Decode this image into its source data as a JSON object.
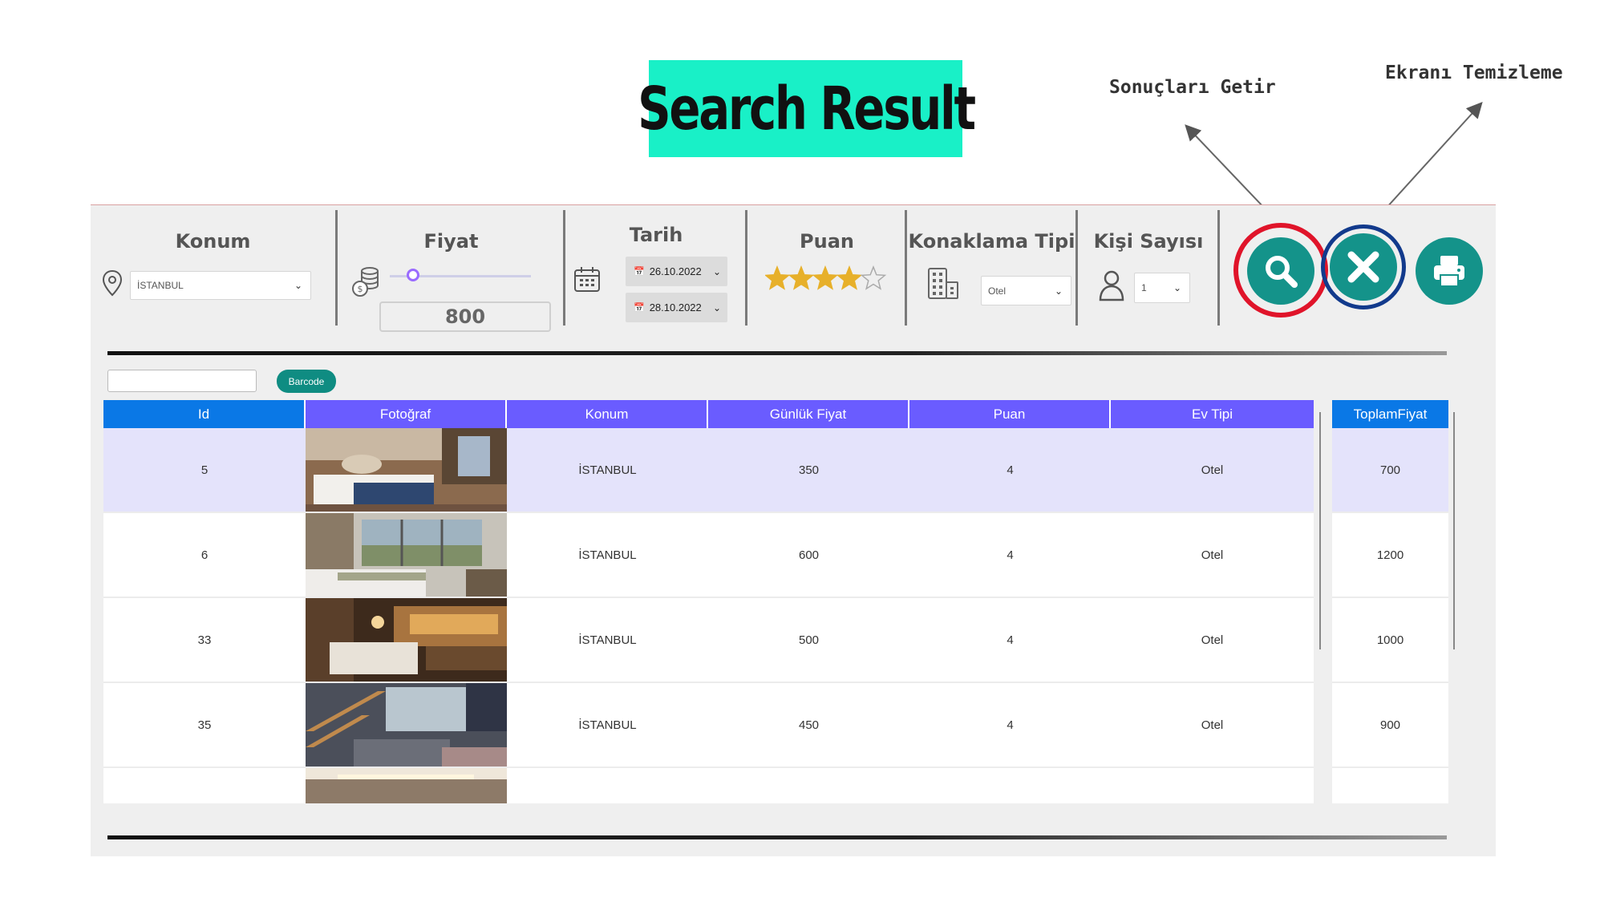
{
  "page_title": "Search Result",
  "annotations": {
    "search_results": "Sonuçları Getir",
    "clear_screen": "Ekranı Temizleme"
  },
  "filters": {
    "location": {
      "label": "Konum",
      "value": "İSTANBUL"
    },
    "price": {
      "label": "Fiyat",
      "value": "800",
      "slider_fraction": 0.13
    },
    "date": {
      "label": "Tarih",
      "start": "26.10.2022",
      "end": "28.10.2022"
    },
    "rating": {
      "label": "Puan",
      "stars_filled": 4,
      "stars_total": 5
    },
    "accommodation_type": {
      "label": "Konaklama Tipi",
      "value": "Otel"
    },
    "guest_count": {
      "label": "Kişi Sayısı",
      "value": "1"
    }
  },
  "actions": {
    "search_icon": "search-icon",
    "clear_icon": "close-icon",
    "print_icon": "printer-icon"
  },
  "barcode": {
    "button_label": "Barcode",
    "input_value": ""
  },
  "table": {
    "headers": [
      "Id",
      "Fotoğraf",
      "Konum",
      "Günlük Fiyat",
      "Puan",
      "Ev Tipi"
    ],
    "rows": [
      {
        "id": "5",
        "location": "İSTANBUL",
        "daily_price": "350",
        "rating": "4",
        "type": "Otel",
        "selected": true
      },
      {
        "id": "6",
        "location": "İSTANBUL",
        "daily_price": "600",
        "rating": "4",
        "type": "Otel",
        "selected": false
      },
      {
        "id": "33",
        "location": "İSTANBUL",
        "daily_price": "500",
        "rating": "4",
        "type": "Otel",
        "selected": false
      },
      {
        "id": "35",
        "location": "İSTANBUL",
        "daily_price": "450",
        "rating": "4",
        "type": "Otel",
        "selected": false
      }
    ]
  },
  "totals": {
    "header": "ToplamFiyat",
    "values": [
      "700",
      "1200",
      "1000",
      "900"
    ]
  },
  "colors": {
    "title_bg": "#19f0c7",
    "header_id_bg": "#0a78e6",
    "header_bg": "#6a5cff",
    "selected_row": "#e4e3fb",
    "teal": "#14938a",
    "star": "#e7b02a",
    "ring_red": "#e0142a",
    "ring_blue": "#123a8c"
  }
}
